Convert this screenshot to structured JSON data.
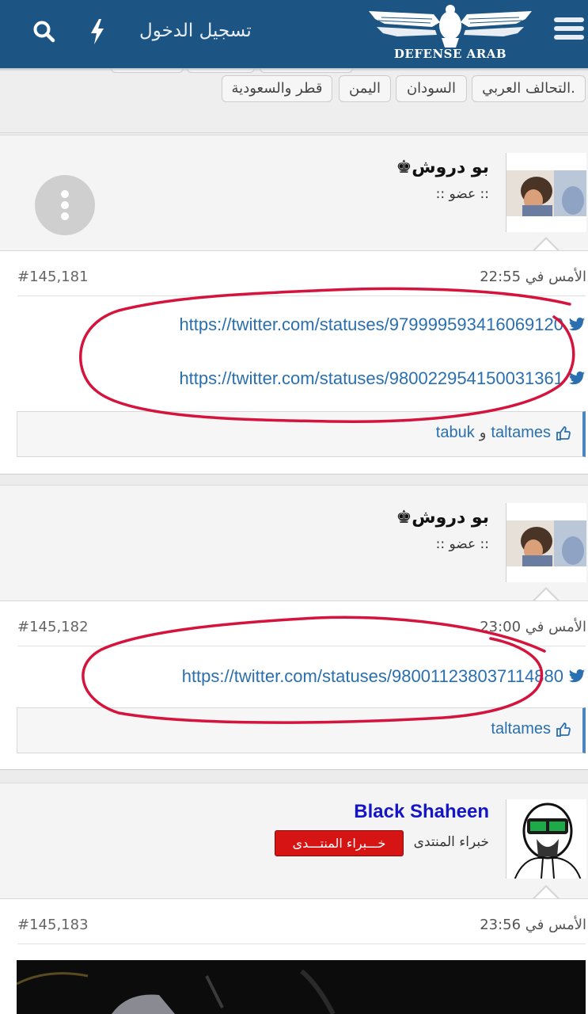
{
  "header": {
    "login_label": "تسجيل الدخول",
    "logo_text": "DEFENSE ARAB",
    "icons": [
      "search-icon",
      "bolt-icon",
      "hamburger-menu-icon"
    ],
    "background": "#1c5583"
  },
  "tags": [
    "التحالف العربي.",
    "السودان",
    "اليمن",
    "قطر والسعودية"
  ],
  "posts": [
    {
      "username": "بو دروش♚",
      "user_title": ":: عضو ::",
      "date": "الأمس في 22:55",
      "number": "#145,181",
      "links": [
        "https://twitter.com/statuses/979999593416069120",
        "https://twitter.com/statuses/980022954150031361"
      ],
      "likes": {
        "first": "tabuk",
        "conjunction": "و",
        "second": "taltames"
      }
    },
    {
      "username": "بو دروش♚",
      "user_title": ":: عضو ::",
      "date": "الأمس في 23:00",
      "number": "#145,182",
      "links": [
        "https://twitter.com/statuses/980011238037114880"
      ],
      "likes": {
        "names": "taltames"
      }
    },
    {
      "username": "Black Shaheen",
      "user_title": "خبراء المنتدى",
      "badge": "خـــبراء المنتـــدى",
      "date": "الأمس في 23:56",
      "number": "#145,183"
    }
  ],
  "colors": {
    "link": "#2a6fb0",
    "annotation": "#d4143c",
    "badge": "#d71414",
    "expert_name": "#1515c8"
  }
}
